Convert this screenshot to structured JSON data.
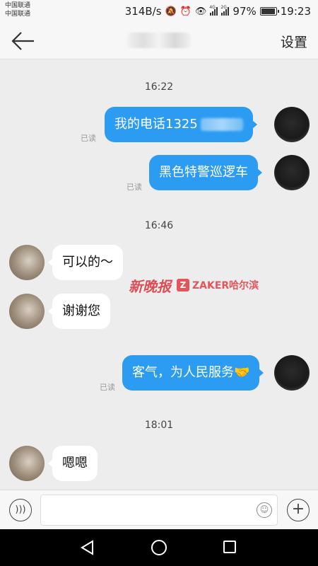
{
  "status_bar": {
    "carrier_1": "中国联通",
    "carrier_2": "中国联通",
    "net_speed": "314B/s",
    "signal_1_tag": "4G",
    "signal_2_tag": "2G",
    "battery": "97%",
    "battery_level": 0.97,
    "time": "19:23"
  },
  "header": {
    "back_icon": "arrow-left-icon",
    "settings_label": "设置"
  },
  "messages": {
    "t1": "16:22",
    "m1_prefix": "我的电话1325",
    "m1_read": "已读",
    "m2": "黑色特警巡逻车",
    "m2_read": "已读",
    "t2": "16:46",
    "m3": "可以的～",
    "m4": "谢谢您",
    "m5": "客气，为人民服务🤝",
    "m5_read": "已读",
    "t3": "18:01",
    "m6": "嗯嗯"
  },
  "watermark": {
    "logo_1": "新晚报",
    "logo_2_mark": "Z",
    "logo_2": "ZAKER哈尔滨"
  },
  "input_bar": {
    "voice_icon": "voice-icon",
    "emoji_icon": "emoji-icon",
    "plus_icon": "plus-icon",
    "placeholder": ""
  },
  "colors": {
    "outgoing_bubble": "#2c9cf2",
    "incoming_bubble": "#ffffff",
    "background": "#ededed"
  }
}
